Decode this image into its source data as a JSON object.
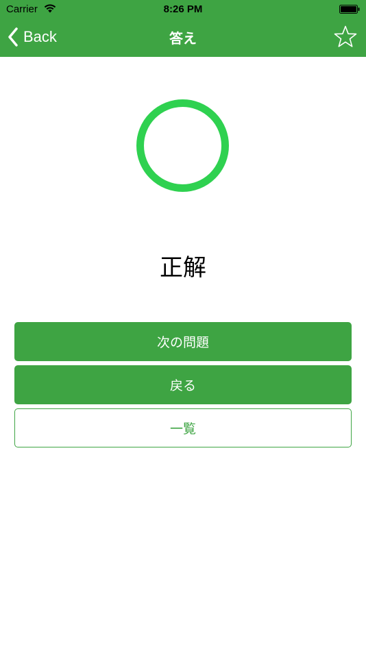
{
  "status_bar": {
    "carrier": "Carrier",
    "time": "8:26 PM"
  },
  "nav": {
    "back_label": "Back",
    "title": "答え",
    "favorite_icon": "star-outline-icon"
  },
  "result": {
    "symbol_icon": "circle-correct-icon",
    "label": "正解"
  },
  "actions": {
    "next_label": "次の問題",
    "return_label": "戻る",
    "list_label": "一覧"
  },
  "colors": {
    "brand_green": "#3ea443",
    "correct_circle": "#2fd150"
  }
}
